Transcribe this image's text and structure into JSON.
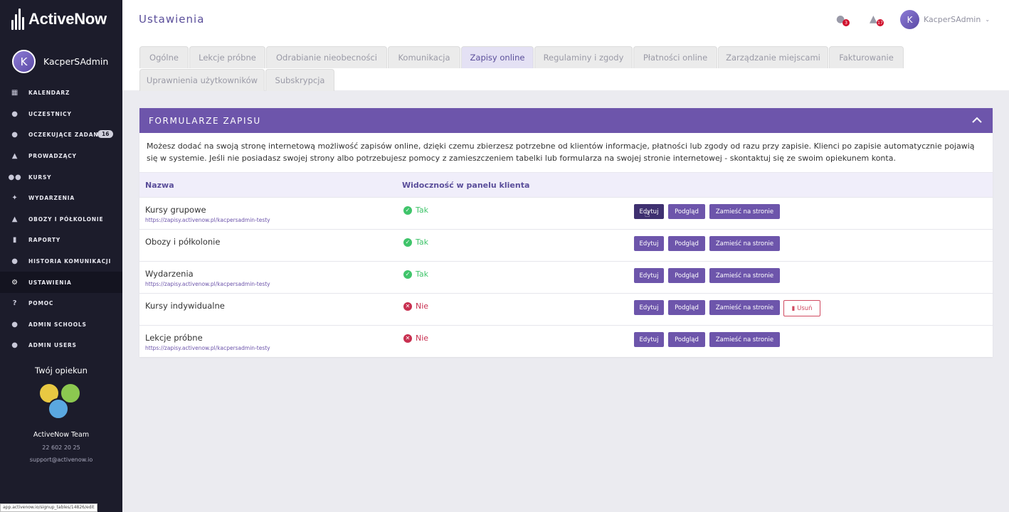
{
  "app": {
    "name": "ActiveNow"
  },
  "sidebar": {
    "user_initial": "K",
    "user_name": "KacperSAdmin",
    "items": [
      {
        "label": "KALENDARZ",
        "icon": "calendar-icon"
      },
      {
        "label": "UCZESTNICY",
        "icon": "user-icon"
      },
      {
        "label": "OCZEKUJĄCE ZADANIA",
        "icon": "user-clock-icon",
        "badge": "16"
      },
      {
        "label": "PROWADZĄCY",
        "icon": "graduation-cap-icon"
      },
      {
        "label": "KURSY",
        "icon": "users-icon"
      },
      {
        "label": "WYDARZENIA",
        "icon": "dance-icon"
      },
      {
        "label": "OBOZY I PÓŁKOLONIE",
        "icon": "tent-icon"
      },
      {
        "label": "RAPORTY",
        "icon": "chart-icon"
      },
      {
        "label": "HISTORIA KOMUNIKACJI",
        "icon": "chat-icon"
      },
      {
        "label": "USTAWIENIA",
        "icon": "gear-icon",
        "active": true
      },
      {
        "label": "POMOC",
        "icon": "help-icon"
      },
      {
        "label": "ADMIN SCHOOLS",
        "icon": "user-icon"
      },
      {
        "label": "ADMIN USERS",
        "icon": "user-icon"
      }
    ],
    "caretaker": {
      "title": "Twój opiekun",
      "name": "ActiveNow Team",
      "phone": "22 602 20 25",
      "email": "support@activenow.io"
    },
    "status_url": "app.activenow.io/signup_tables/14826/edit"
  },
  "header": {
    "title": "Ustawienia",
    "messages_badge": "3",
    "notifications_badge": "17",
    "user_initial": "K",
    "user_name": "KacperSAdmin"
  },
  "tabs": [
    "Ogólne",
    "Lekcje próbne",
    "Odrabianie nieobecności",
    "Komunikacja",
    "Zapisy online",
    "Regulaminy i zgody",
    "Płatności online",
    "Zarządzanie miejscami",
    "Fakturowanie",
    "Uprawnienia użytkowników",
    "Subskrypcja"
  ],
  "active_tab": "Zapisy online",
  "panel": {
    "title": "FORMULARZE ZAPISU",
    "description": "Możesz dodać na swoją stronę internetową możliwość zapisów online, dzięki czemu zbierzesz potrzebne od klientów informacje, płatności lub zgody od razu przy zapisie. Klienci po zapisie automatycznie pojawią się w systemie. Jeśli nie posiadasz swojej strony albo potrzebujesz pomocy z zamieszczeniem tabelki lub formularza na swojej stronie internetowej - skontaktuj się ze swoim opiekunem konta.",
    "columns": {
      "name": "Nazwa",
      "visibility": "Widoczność w panelu klienta"
    },
    "buttons": {
      "edit": "Edytuj",
      "preview": "Podgląd",
      "embed": "Zamieść na stronie",
      "delete": "Usuń"
    },
    "rows": [
      {
        "name": "Kursy grupowe",
        "link": "https://zapisy.activenow.pl/kacpersadmin-testy",
        "visible": true,
        "visibility_label": "Tak"
      },
      {
        "name": "Obozy i półkolonie",
        "link": "",
        "visible": true,
        "visibility_label": "Tak"
      },
      {
        "name": "Wydarzenia",
        "link": "https://zapisy.activenow.pl/kacpersadmin-testy",
        "visible": true,
        "visibility_label": "Tak"
      },
      {
        "name": "Kursy indywidualne",
        "link": "",
        "visible": false,
        "visibility_label": "Nie",
        "deletable": true
      },
      {
        "name": "Lekcje próbne",
        "link": "https://zapisy.activenow.pl/kacpersadmin-testy",
        "visible": false,
        "visibility_label": "Nie"
      }
    ]
  },
  "colors": {
    "accent": "#6d55ab",
    "sidebar": "#1c1c2b",
    "yes": "#3fc46a",
    "no": "#c83050"
  }
}
